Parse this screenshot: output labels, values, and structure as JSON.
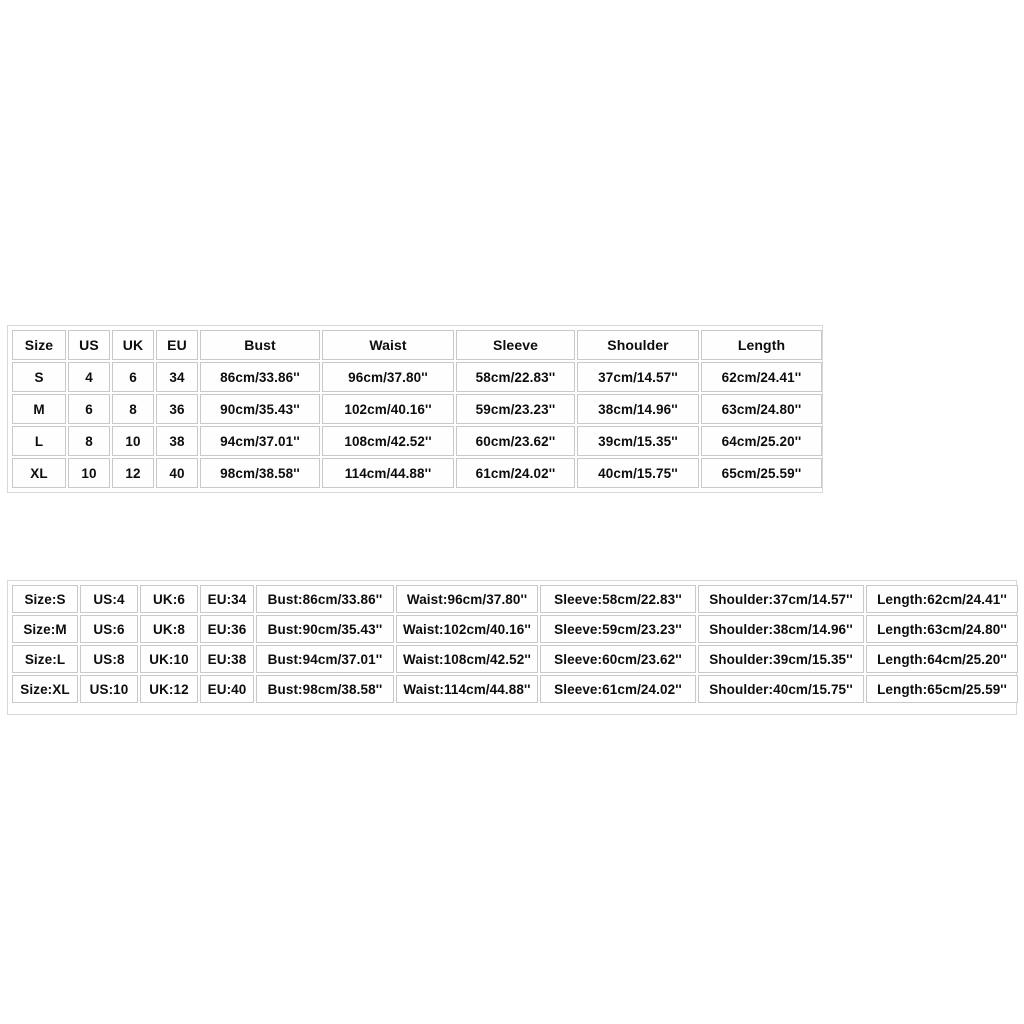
{
  "top_table": {
    "name": "size-chart-table",
    "headers": [
      "Size",
      "US",
      "UK",
      "EU",
      "Bust",
      "Waist",
      "Sleeve",
      "Shoulder",
      "Length"
    ],
    "rows": [
      [
        "S",
        "4",
        "6",
        "34",
        "86cm/33.86''",
        "96cm/37.80''",
        "58cm/22.83''",
        "37cm/14.57''",
        "62cm/24.41''"
      ],
      [
        "M",
        "6",
        "8",
        "36",
        "90cm/35.43''",
        "102cm/40.16''",
        "59cm/23.23''",
        "38cm/14.96''",
        "63cm/24.80''"
      ],
      [
        "L",
        "8",
        "10",
        "38",
        "94cm/37.01''",
        "108cm/42.52''",
        "60cm/23.62''",
        "39cm/15.35''",
        "64cm/25.20''"
      ],
      [
        "XL",
        "10",
        "12",
        "40",
        "98cm/38.58''",
        "114cm/44.88''",
        "61cm/24.02''",
        "40cm/15.75''",
        "65cm/25.59''"
      ]
    ]
  },
  "bottom_table": {
    "name": "size-chart-labeled-table",
    "rows": [
      [
        "Size:S",
        "US:4",
        "UK:6",
        "EU:34",
        "Bust:86cm/33.86''",
        "Waist:96cm/37.80''",
        "Sleeve:58cm/22.83''",
        "Shoulder:37cm/14.57''",
        "Length:62cm/24.41''"
      ],
      [
        "Size:M",
        "US:6",
        "UK:8",
        "EU:36",
        "Bust:90cm/35.43''",
        "Waist:102cm/40.16''",
        "Sleeve:59cm/23.23''",
        "Shoulder:38cm/14.96''",
        "Length:63cm/24.80''"
      ],
      [
        "Size:L",
        "US:8",
        "UK:10",
        "EU:38",
        "Bust:94cm/37.01''",
        "Waist:108cm/42.52''",
        "Sleeve:60cm/23.62''",
        "Shoulder:39cm/15.35''",
        "Length:64cm/25.20''"
      ],
      [
        "Size:XL",
        "US:10",
        "UK:12",
        "EU:40",
        "Bust:98cm/38.58''",
        "Waist:114cm/44.88''",
        "Sleeve:61cm/24.02''",
        "Shoulder:40cm/15.75''",
        "Length:65cm/25.59''"
      ]
    ]
  },
  "layout": {
    "top_col_widths": [
      "54px",
      "42px",
      "42px",
      "42px",
      "120px",
      "132px",
      "119px",
      "122px",
      "121px"
    ],
    "bottom_col_widths": [
      "66px",
      "58px",
      "58px",
      "54px",
      "138px",
      "142px",
      "156px",
      "166px",
      "152px"
    ]
  },
  "colors": {
    "text": "#0d0d0d",
    "cell_background": "#fefefe",
    "cell_border": "#c9c9c7",
    "frame_border": "#d8d8d6",
    "page_background": "#ffffff"
  }
}
